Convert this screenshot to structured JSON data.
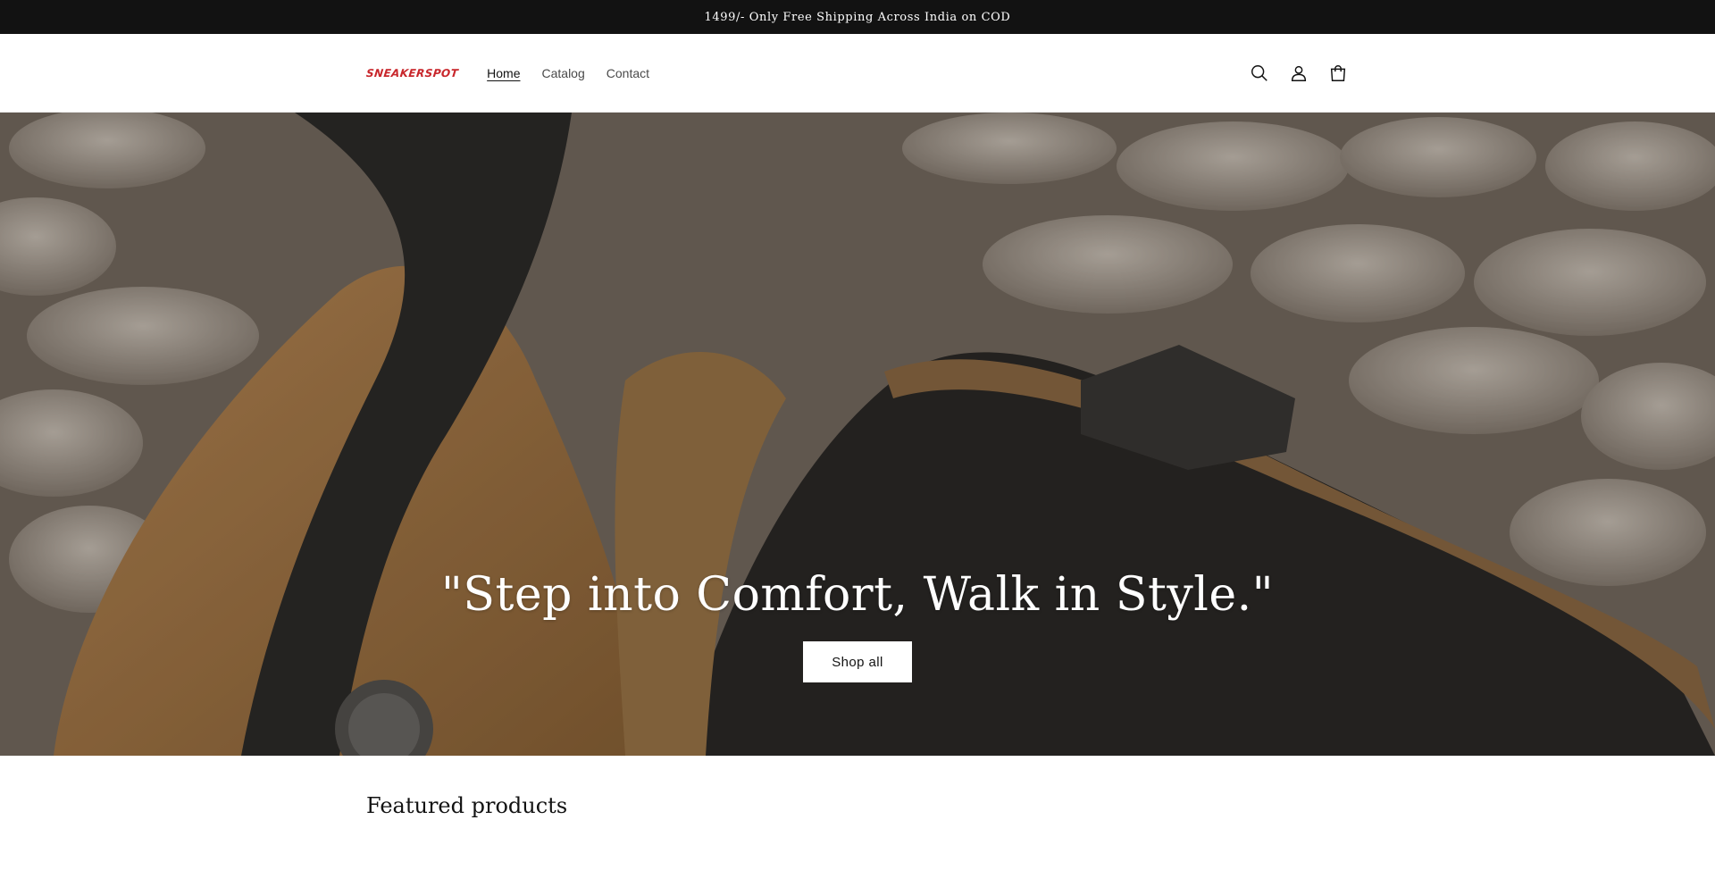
{
  "announcement": {
    "text": "1499/- Only Free Shipping Across India on COD"
  },
  "header": {
    "logo_text": "SNEAKERSPOT",
    "nav": [
      {
        "label": "Home",
        "active": true
      },
      {
        "label": "Catalog",
        "active": false
      },
      {
        "label": "Contact",
        "active": false
      }
    ],
    "icons": [
      "search-icon",
      "account-icon",
      "cart-icon"
    ]
  },
  "hero": {
    "heading": "\"Step into Comfort, Walk in Style.\"",
    "button_label": "Shop all"
  },
  "featured": {
    "title": "Featured products"
  },
  "colors": {
    "announcement_bg": "#121212",
    "brand_red": "#c8262b",
    "text": "#121212"
  }
}
